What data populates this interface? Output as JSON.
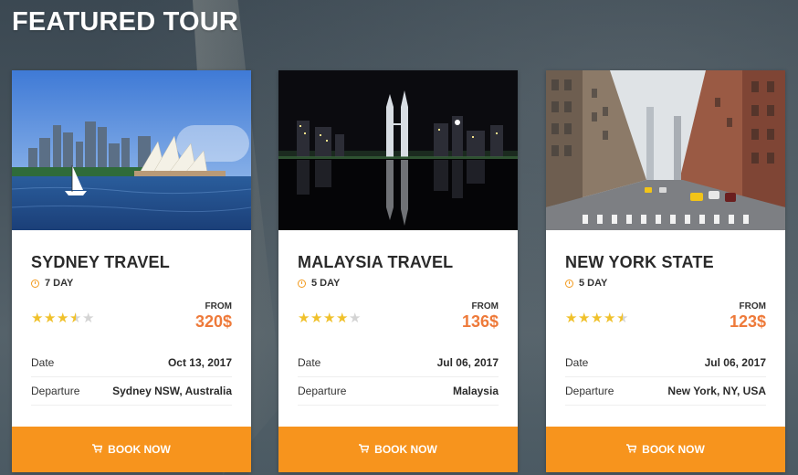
{
  "section": {
    "title": "FEATURED TOUR"
  },
  "tours": [
    {
      "title": "SYDNEY TRAVEL",
      "duration": "7 DAY",
      "rating": 3.5,
      "price_label": "FROM",
      "price": "320$",
      "details": [
        {
          "label": "Date",
          "value": "Oct 13, 2017"
        },
        {
          "label": "Departure",
          "value": "Sydney NSW, Australia"
        }
      ],
      "button_label": "BOOK NOW"
    },
    {
      "title": "MALAYSIA TRAVEL",
      "duration": "5 DAY",
      "rating": 4,
      "price_label": "FROM",
      "price": "136$",
      "details": [
        {
          "label": "Date",
          "value": "Jul 06, 2017"
        },
        {
          "label": "Departure",
          "value": "Malaysia"
        }
      ],
      "button_label": "BOOK NOW"
    },
    {
      "title": "NEW YORK STATE",
      "duration": "5 DAY",
      "rating": 4.5,
      "price_label": "FROM",
      "price": "123$",
      "details": [
        {
          "label": "Date",
          "value": "Jul 06, 2017"
        },
        {
          "label": "Departure",
          "value": "New York, NY, USA"
        }
      ],
      "button_label": "BOOK NOW"
    }
  ],
  "colors": {
    "accent": "#f7941d",
    "price": "#ee7a3a",
    "star": "#f0c12b"
  },
  "icons": {
    "duration": "clock-icon",
    "button": "cart-icon",
    "rating": "star-icon"
  }
}
